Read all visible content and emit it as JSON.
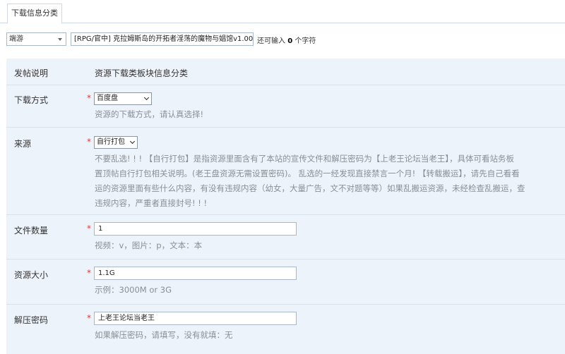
{
  "tab": {
    "label": "下载信息分类"
  },
  "category_select": {
    "value": "端游"
  },
  "title_input": {
    "value": "[RPG/官中] 克拉姆斯岛的开拓者淫荡的魔物与娼馆v1.00"
  },
  "char_counter": {
    "prefix": "还可输入",
    "count": "0",
    "suffix": "个字符"
  },
  "form": {
    "intro": {
      "label": "发帖说明",
      "text": "资源下载类板块信息分类"
    },
    "download_method": {
      "label": "下载方式",
      "required": "*",
      "value": "百度盘",
      "hint": "资源的下载方式，请认真选择!"
    },
    "source": {
      "label": "来源",
      "required": "*",
      "value": "自行打包",
      "desc_lines": [
        "不要乱选! ! ! 【自行打包】是指资源里面含有了本站的宣传文件和解压密码为【上老王论坛当老王】，具体可看站务板",
        "置顶帖自行打包相关说明。(老王盘资源无需设置密码)。 乱选的一经发现直接禁言一个月! 【转载搬运】，请先自己看看",
        "运的资源里面有些什么内容，有没有违规内容（幼女，大量广告，文不对题等等）如果乱搬运资源，未经检查乱搬运，查",
        "违规内容，严重者直接封号! ! !"
      ]
    },
    "file_count": {
      "label": "文件数量",
      "required": "*",
      "value": "1",
      "hint": "视频：v，图片：p，文本：本"
    },
    "size": {
      "label": "资源大小",
      "required": "*",
      "value": "1.1G",
      "hint": "示例：3000M or 3G"
    },
    "password": {
      "label": "解压密码",
      "required": "*",
      "value": "上老王论坛当老王",
      "hint": "如果解压密码，请填写，没有就填：无"
    }
  }
}
